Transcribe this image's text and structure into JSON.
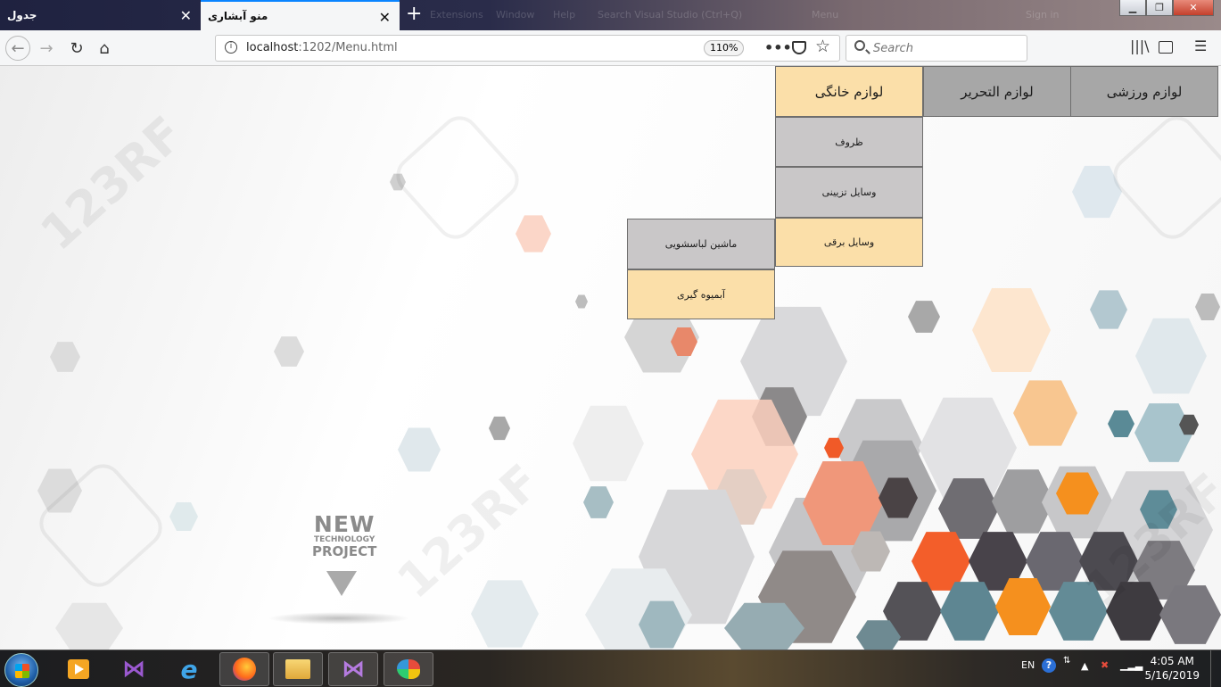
{
  "browser": {
    "tabs": [
      {
        "title": "جدول",
        "active": false
      },
      {
        "title": "منو آبشاری",
        "active": true
      }
    ],
    "new_tab_symbol": "+",
    "close_symbol": "✕",
    "window_controls": {
      "minimize": "▁",
      "maximize": "❐",
      "close": "✕"
    },
    "url_host": "localhost",
    "url_rest": ":1202/Menu.html",
    "zoom": "110%",
    "search_placeholder": "Search",
    "ghost_menu": [
      "Extensions",
      "Window",
      "Help",
      "Search Visual Studio (Ctrl+Q)",
      "Menu",
      "Sign in"
    ]
  },
  "menu": {
    "top": [
      {
        "label": "لوازم ورزشی",
        "highlighted": false
      },
      {
        "label": "لوازم التحریر",
        "highlighted": false
      },
      {
        "label": "لوازم خانگی",
        "highlighted": true
      }
    ],
    "home_submenu": [
      {
        "label": "ظروف",
        "highlighted": false
      },
      {
        "label": "وسایل تزیینی",
        "highlighted": false
      },
      {
        "label": "وسایل برقی",
        "highlighted": true
      }
    ],
    "electrical_submenu": [
      {
        "label": "ماشین لباسشویی",
        "highlighted": false
      },
      {
        "label": "آبمیوه گیری",
        "highlighted": true
      }
    ]
  },
  "background": {
    "watermark": "123RF",
    "tagline": {
      "line1": "NEW",
      "line2": "TECHNOLOGY",
      "line3": "PROJECT"
    }
  },
  "taskbar": {
    "language": "EN",
    "time": "4:05 AM",
    "date": "5/16/2019"
  },
  "colors": {
    "menu_item": "#a7a7a7",
    "submenu_item": "#c9c7c8",
    "highlight": "#fbdfa9",
    "tab_accent": "#0a84ff"
  }
}
